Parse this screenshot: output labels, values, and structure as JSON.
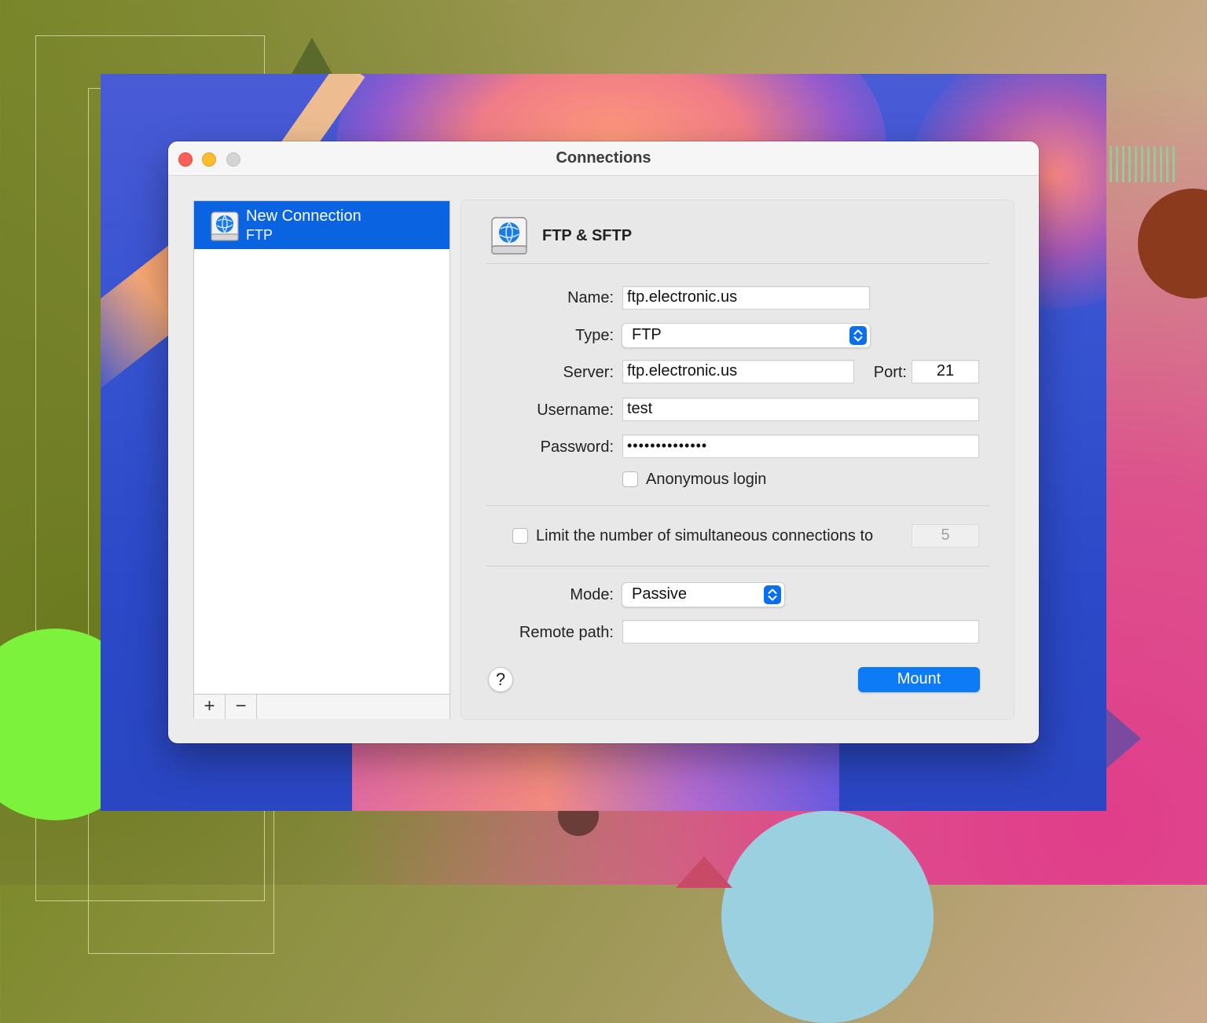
{
  "window": {
    "title": "Connections"
  },
  "sidebar": {
    "items": [
      {
        "name": "New Connection",
        "type": "FTP",
        "selected": true
      }
    ],
    "add_label": "+",
    "remove_label": "−"
  },
  "panel": {
    "header_title": "FTP & SFTP",
    "name_label": "Name:",
    "name_value": "ftp.electronic.us",
    "type_label": "Type:",
    "type_value": "FTP",
    "server_label": "Server:",
    "server_value": "ftp.electronic.us",
    "port_label": "Port:",
    "port_value": "21",
    "username_label": "Username:",
    "username_value": "test",
    "password_label": "Password:",
    "password_value": "••••••••••••••",
    "anonymous_label": "Anonymous login",
    "anonymous_checked": false,
    "limit_label": "Limit the number of simultaneous connections to",
    "limit_checked": false,
    "limit_value": "5",
    "mode_label": "Mode:",
    "mode_value": "Passive",
    "remote_path_label": "Remote path:",
    "remote_path_value": "",
    "help_label": "?",
    "mount_label": "Mount"
  },
  "colors": {
    "accent": "#0a63e0",
    "mount_button": "#0d7bf5",
    "close": "#fe5f57",
    "minimize": "#febc2e",
    "zoom": "#d4d4d4"
  }
}
